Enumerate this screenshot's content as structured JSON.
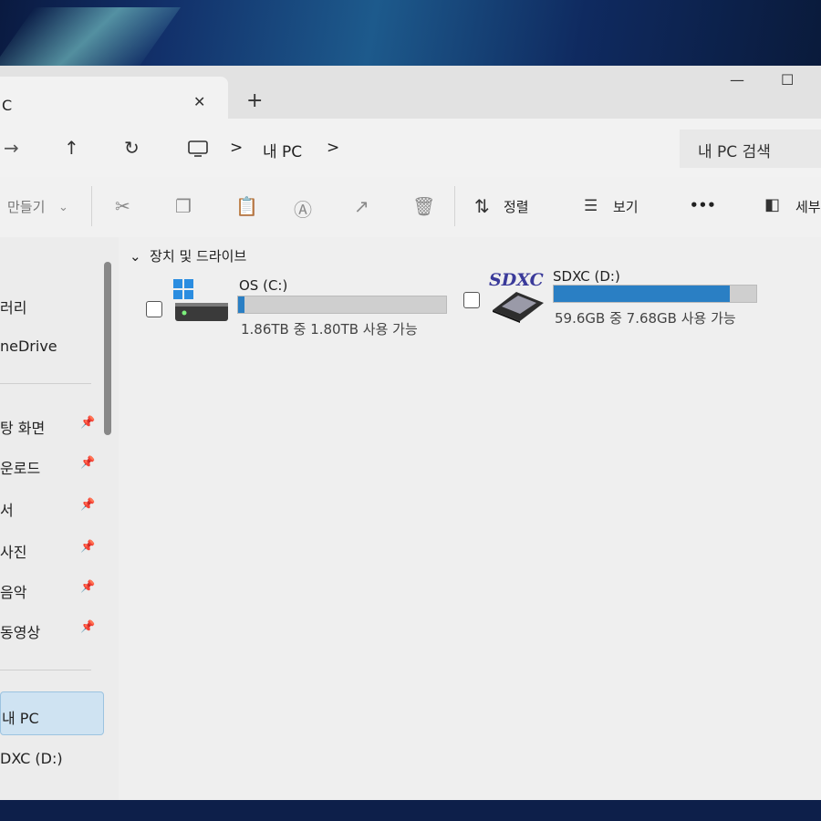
{
  "window": {
    "tab_title": "C",
    "tab_close": "✕",
    "new_tab": "+",
    "minimize": "—",
    "maximize": "☐"
  },
  "address": {
    "back_icon": "←",
    "forward_icon": "→",
    "up_icon": "↑",
    "refresh_icon": "↻",
    "crumb_sep": ">",
    "crumb_label": "내 PC",
    "search_placeholder": "내 PC 검색"
  },
  "toolbar": {
    "new_label": "만들기",
    "sort_label": "정렬",
    "view_label": "보기",
    "more_label": "•••",
    "details_label": "세부"
  },
  "sidebar": {
    "items": [
      {
        "label": "러리"
      },
      {
        "label": "neDrive"
      },
      {
        "label": "탕 화면",
        "pinned": true
      },
      {
        "label": "운로드",
        "pinned": true
      },
      {
        "label": "서",
        "pinned": true
      },
      {
        "label": "사진",
        "pinned": true
      },
      {
        "label": "음악",
        "pinned": true
      },
      {
        "label": "동영상",
        "pinned": true
      },
      {
        "label": "내 PC",
        "selected": true
      },
      {
        "label": "DXC (D:)"
      }
    ]
  },
  "main": {
    "section_header": "장치 및 드라이브",
    "drives": [
      {
        "name": "OS (C:)",
        "used_fraction": 0.03,
        "free_text": "1.86TB 중 1.80TB 사용 가능",
        "icon": "windows-hard-drive-icon"
      },
      {
        "name": "SDXC (D:)",
        "used_fraction": 0.87,
        "free_text": "59.6GB 중 7.68GB 사용 가능",
        "icon": "sdxc-card-icon",
        "icon_text": "SDXC"
      }
    ]
  },
  "colors": {
    "accent": "#2a7fc4",
    "selected_bg": "#cfe3f2"
  }
}
